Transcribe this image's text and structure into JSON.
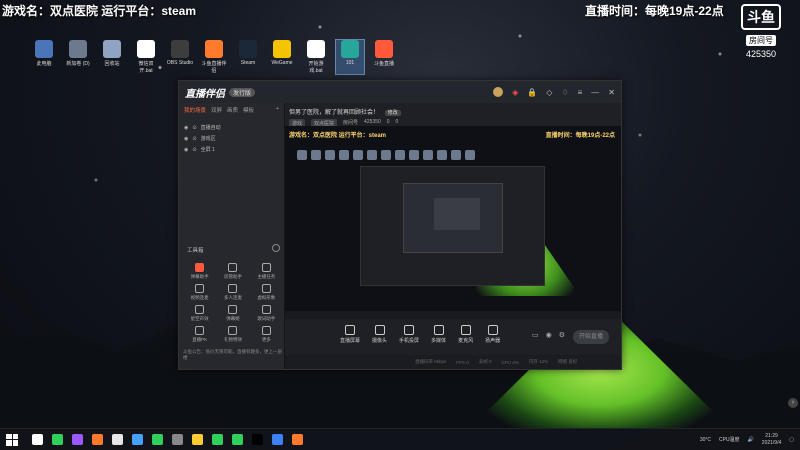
{
  "overlay": {
    "game_line": "游戏名：双点医院   运行平台：steam",
    "time_line": "直播时间：每晚19点-22点",
    "logo_text": "斗鱼",
    "logo_sub": "房间号",
    "room_number": "425350"
  },
  "desktop_icons": [
    {
      "label": "此电脑",
      "color": "#4a76b8"
    },
    {
      "label": "新加卷 (D)",
      "color": "#6d7a8d"
    },
    {
      "label": "回收站",
      "color": "#8fa3c2"
    },
    {
      "label": "微信双开.bat",
      "color": "#ffffff"
    },
    {
      "label": "OBS Studio",
      "color": "#3d3d3d"
    },
    {
      "label": "斗鱼直播伴侣",
      "color": "#ff7a2d"
    },
    {
      "label": "Steam",
      "color": "#1b2838"
    },
    {
      "label": "WeGame",
      "color": "#f5c400"
    },
    {
      "label": "开始游戏.bat",
      "color": "#ffffff"
    },
    {
      "label": "101",
      "color": "#27a69a"
    },
    {
      "label": "斗鱼直播",
      "color": "#ff5a3c"
    }
  ],
  "app": {
    "name": "直播伴侣",
    "version_badge": "发行版",
    "sidebar_tabs": [
      "我的场景",
      "双屏",
      "画质",
      "模板"
    ],
    "scenes": [
      "直播自动",
      "游戏区",
      "全屏 1"
    ],
    "tools_title": "工具箱",
    "tools": [
      "弹幕助手",
      "房管助手",
      "主播任务",
      "视频连麦",
      "多人连麦",
      "虚拟形象",
      "星空声效",
      "弹幕姬",
      "歌词助手",
      "直播PK",
      "礼物特效",
      "更多"
    ],
    "sidebar_footer": "斗鱼公告：低价无限可能，直播有趣多，更上一层楼",
    "stream_title": "但男了医院，解了就再回顾社会！",
    "edit_label": "修改",
    "meta": {
      "category": "游戏",
      "subcategory": "双点医院",
      "room_label": "房间号",
      "room": "425350",
      "likes": "0",
      "viewers": "0"
    },
    "preview_game": "游戏名：双点医院   运行平台：steam",
    "preview_time": "直播时间：每晚19点-22点",
    "bottom_tools": [
      "直播屏幕",
      "摄像头",
      "手机投屏",
      "多媒体",
      "麦克风",
      "扬声器"
    ],
    "start_button": "开始直播",
    "status_bits": [
      "直播码率 0kbps",
      "FPS 0",
      "丢帧 0",
      "CPU 4%",
      "内存 12%",
      "网络 良好"
    ]
  },
  "taskbar": {
    "app_colors": [
      "#ffffff",
      "#2fd05c",
      "#9b59ff",
      "#ff7a2d",
      "#e6e6e6",
      "#45a1ff",
      "#2fd05c",
      "#888888",
      "#ffcc33",
      "#2fd05c",
      "#2fd05c",
      "#000000",
      "#3d82f2",
      "#ff7a2d"
    ],
    "weather": "30°C",
    "weather_label": "CPU温度",
    "time": "21:29",
    "date": "2021/9/4"
  }
}
